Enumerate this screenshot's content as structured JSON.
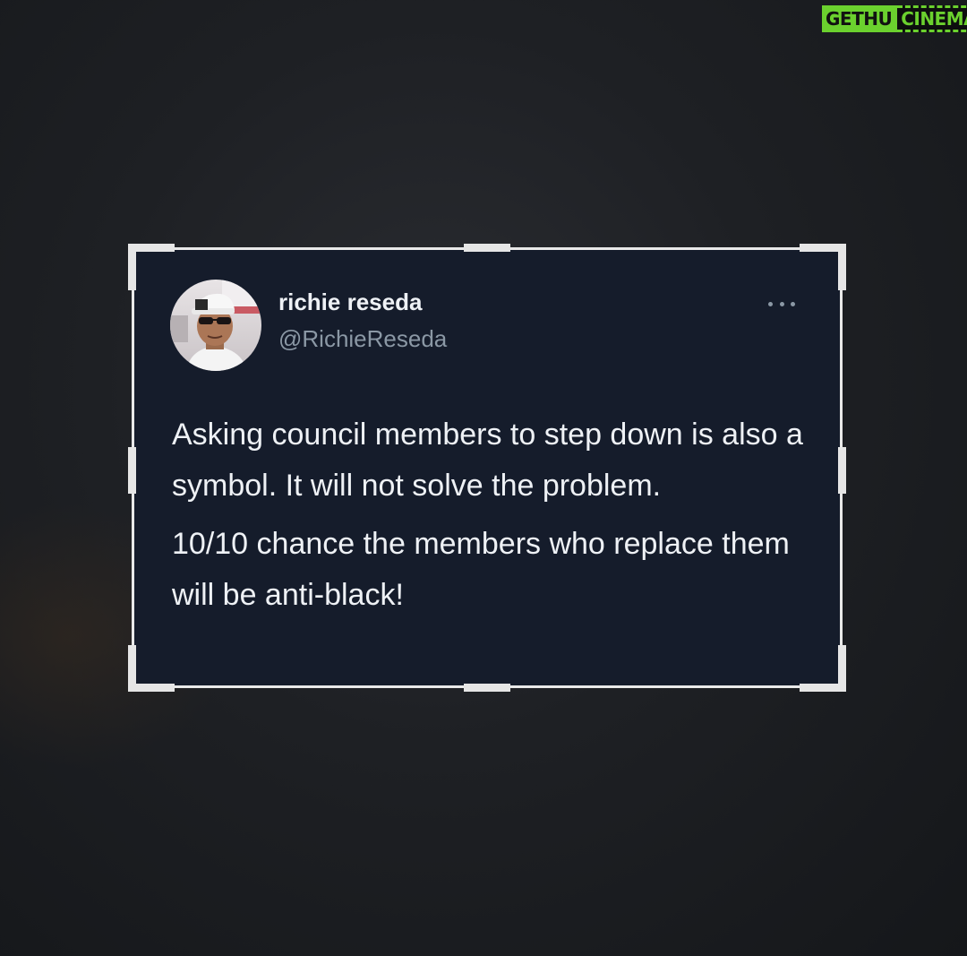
{
  "watermark": {
    "part1": "GETHU",
    "part2": "CINEMA"
  },
  "tweet": {
    "author_name": "richie reseda",
    "author_handle": "@RichieReseda",
    "more_icon": "ellipsis-icon",
    "paragraphs": [
      "Asking council members to step down is also a symbol. It will not solve the problem.",
      "10/10 chance the members who replace them will be anti-black!"
    ]
  },
  "colors": {
    "card_background": "#151c2b",
    "frame_border": "#e9e9e9",
    "text_primary": "#eef1f5",
    "text_secondary": "#8b98a5",
    "watermark_green": "#6bd12e"
  }
}
